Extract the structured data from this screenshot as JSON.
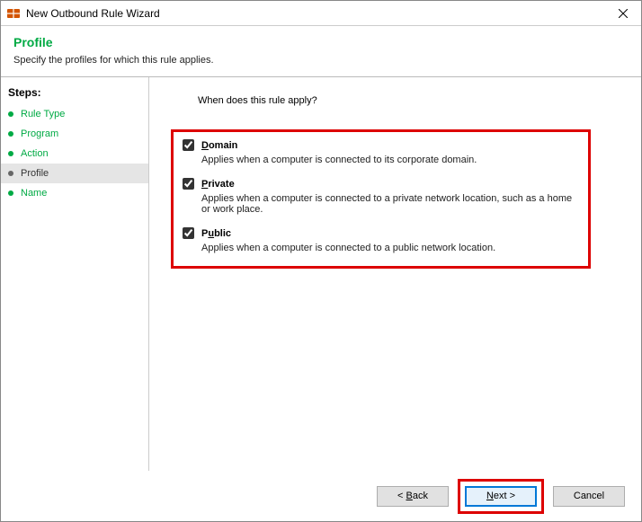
{
  "window": {
    "title": "New Outbound Rule Wizard"
  },
  "header": {
    "heading": "Profile",
    "subtitle": "Specify the profiles for which this rule applies."
  },
  "sidebar": {
    "title": "Steps:",
    "items": [
      {
        "label": "Rule Type"
      },
      {
        "label": "Program"
      },
      {
        "label": "Action"
      },
      {
        "label": "Profile"
      },
      {
        "label": "Name"
      }
    ]
  },
  "main": {
    "question": "When does this rule apply?",
    "profiles": [
      {
        "label": "Domain",
        "accel": "D",
        "desc": "Applies when a computer is connected to its corporate domain."
      },
      {
        "label": "Private",
        "accel": "P",
        "desc": "Applies when a computer is connected to a private network location, such as a home or work place."
      },
      {
        "label": "Public",
        "accel": "u",
        "desc": "Applies when a computer is connected to a public network location."
      }
    ]
  },
  "footer": {
    "back": "< Back",
    "back_accel": "B",
    "next": "Next >",
    "next_accel": "N",
    "cancel": "Cancel"
  }
}
